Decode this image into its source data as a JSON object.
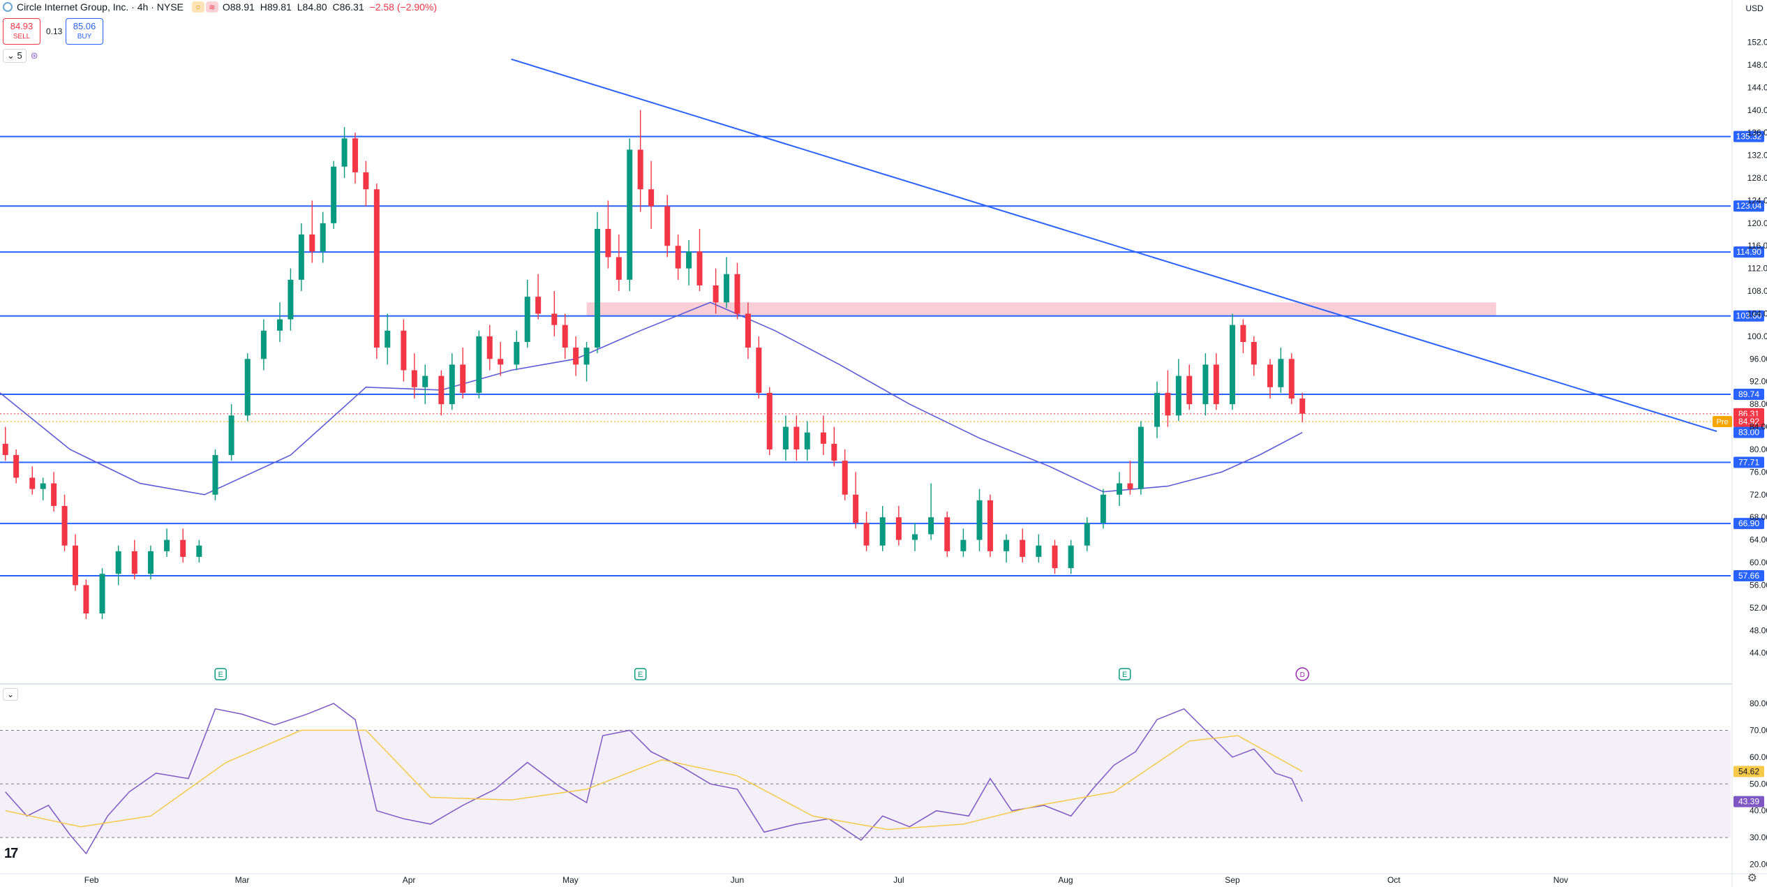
{
  "header": {
    "symbol_title": "Circle Internet Group, Inc. · 4h · NYSE",
    "ohlc": {
      "open": "O88.91",
      "high": "H89.81",
      "low": "L84.80",
      "close": "C86.31",
      "change": "−2.58 (−2.90%)"
    },
    "sell_price": "84.93",
    "sell_label": "SELL",
    "buy_price": "85.06",
    "buy_label": "BUY",
    "spread": "0.13",
    "indicator_count": "5",
    "currency": "USD"
  },
  "colors": {
    "up": "#089981",
    "down": "#f23645",
    "hline": "#2962ff",
    "ma": "#5b5bd6",
    "rsi": "#7e57c2",
    "rsi_ma": "#f7c948",
    "zone": "#f8c6cf"
  },
  "icons": [
    "earnings-icon",
    "dividend-icon",
    "settings-gear-icon",
    "tradingview-logo-icon"
  ],
  "price_axis": [
    "152.00",
    "148.00",
    "144.00",
    "140.00",
    "136.00",
    "132.00",
    "128.00",
    "124.00",
    "120.00",
    "116.00",
    "112.00",
    "108.00",
    "104.00",
    "100.00",
    "96.00",
    "92.00",
    "88.00",
    "84.00",
    "80.00",
    "76.00",
    "72.00",
    "68.00",
    "64.00",
    "60.00",
    "56.00",
    "52.00",
    "48.00",
    "44.00"
  ],
  "time_axis": [
    "Feb",
    "Mar",
    "Apr",
    "May",
    "Jun",
    "Jul",
    "Aug",
    "Sep",
    "Oct",
    "Nov"
  ],
  "rsi_axis": [
    "80.00",
    "70.00",
    "60.00",
    "50.00",
    "40.00",
    "30.00",
    "20.00"
  ],
  "chart_data": {
    "type": "candlestick",
    "title": "Circle Internet Group, Inc. · 4h · NYSE",
    "ylim": [
      41,
      157
    ],
    "horizontal_levels": [
      135.32,
      123.04,
      114.9,
      103.6,
      89.74,
      77.71,
      66.9,
      57.66
    ],
    "level_labels": [
      "135.32",
      "123.04",
      "114.90",
      "103.60",
      "89.74",
      "77.71",
      "66.90",
      "57.66"
    ],
    "price_tags": [
      {
        "label": "86.31",
        "value": 86.31,
        "color": "#f23645"
      },
      {
        "label": "84.92",
        "value": 84.92,
        "color": "#f23645",
        "badge": "Pre"
      },
      {
        "label": "83.00",
        "value": 83.0,
        "color": "#2962ff"
      }
    ],
    "resistance_zone": {
      "from_date": "2025-05-04",
      "to_date": "2025-10-20",
      "low": 103.6,
      "high": 106.0
    },
    "trendline": {
      "from": [
        "2025-04-20",
        149.0
      ],
      "to": [
        "2025-11-30",
        83.2
      ]
    },
    "moving_average_path": [
      [
        "2025-01-15",
        90
      ],
      [
        "2025-01-28",
        80
      ],
      [
        "2025-02-10",
        74
      ],
      [
        "2025-02-22",
        72
      ],
      [
        "2025-03-10",
        79
      ],
      [
        "2025-03-24",
        91
      ],
      [
        "2025-04-07",
        90.5
      ],
      [
        "2025-04-20",
        94
      ],
      [
        "2025-05-02",
        96
      ],
      [
        "2025-05-14",
        101
      ],
      [
        "2025-05-27",
        106
      ],
      [
        "2025-06-08",
        101
      ],
      [
        "2025-06-20",
        95
      ],
      [
        "2025-07-03",
        88
      ],
      [
        "2025-07-16",
        82
      ],
      [
        "2025-07-29",
        77
      ],
      [
        "2025-08-08",
        72.5
      ],
      [
        "2025-08-20",
        73.5
      ],
      [
        "2025-08-30",
        76
      ],
      [
        "2025-09-06",
        79
      ],
      [
        "2025-09-14",
        83
      ]
    ],
    "candles": [
      {
        "t": "2025-01-16",
        "o": 81,
        "h": 84,
        "l": 78,
        "c": 79
      },
      {
        "t": "2025-01-18",
        "o": 79,
        "h": 80,
        "l": 74,
        "c": 75
      },
      {
        "t": "2025-01-21",
        "o": 75,
        "h": 77,
        "l": 72,
        "c": 73
      },
      {
        "t": "2025-01-23",
        "o": 73,
        "h": 75,
        "l": 71,
        "c": 74
      },
      {
        "t": "2025-01-25",
        "o": 74,
        "h": 76,
        "l": 69,
        "c": 70
      },
      {
        "t": "2025-01-27",
        "o": 70,
        "h": 72,
        "l": 62,
        "c": 63
      },
      {
        "t": "2025-01-29",
        "o": 63,
        "h": 65,
        "l": 55,
        "c": 56
      },
      {
        "t": "2025-01-31",
        "o": 56,
        "h": 57,
        "l": 50,
        "c": 51
      },
      {
        "t": "2025-02-03",
        "o": 51,
        "h": 59,
        "l": 50,
        "c": 58
      },
      {
        "t": "2025-02-06",
        "o": 58,
        "h": 63,
        "l": 56,
        "c": 62
      },
      {
        "t": "2025-02-09",
        "o": 62,
        "h": 64,
        "l": 57,
        "c": 58
      },
      {
        "t": "2025-02-12",
        "o": 58,
        "h": 63,
        "l": 57,
        "c": 62
      },
      {
        "t": "2025-02-15",
        "o": 62,
        "h": 66,
        "l": 61,
        "c": 64
      },
      {
        "t": "2025-02-18",
        "o": 64,
        "h": 66,
        "l": 60,
        "c": 61
      },
      {
        "t": "2025-02-21",
        "o": 61,
        "h": 64,
        "l": 60,
        "c": 63
      },
      {
        "t": "2025-02-24",
        "o": 72,
        "h": 80,
        "l": 71,
        "c": 79
      },
      {
        "t": "2025-02-27",
        "o": 79,
        "h": 88,
        "l": 78,
        "c": 86
      },
      {
        "t": "2025-03-02",
        "o": 86,
        "h": 97,
        "l": 85,
        "c": 96
      },
      {
        "t": "2025-03-05",
        "o": 96,
        "h": 103,
        "l": 94,
        "c": 101
      },
      {
        "t": "2025-03-08",
        "o": 101,
        "h": 106,
        "l": 99,
        "c": 103
      },
      {
        "t": "2025-03-10",
        "o": 103,
        "h": 112,
        "l": 101,
        "c": 110
      },
      {
        "t": "2025-03-12",
        "o": 110,
        "h": 120,
        "l": 108,
        "c": 118
      },
      {
        "t": "2025-03-14",
        "o": 118,
        "h": 124,
        "l": 113,
        "c": 115
      },
      {
        "t": "2025-03-16",
        "o": 115,
        "h": 122,
        "l": 113,
        "c": 120
      },
      {
        "t": "2025-03-18",
        "o": 120,
        "h": 131,
        "l": 119,
        "c": 130
      },
      {
        "t": "2025-03-20",
        "o": 130,
        "h": 137,
        "l": 128,
        "c": 135
      },
      {
        "t": "2025-03-22",
        "o": 135,
        "h": 136,
        "l": 127,
        "c": 129
      },
      {
        "t": "2025-03-24",
        "o": 129,
        "h": 131,
        "l": 123,
        "c": 126
      },
      {
        "t": "2025-03-26",
        "o": 126,
        "h": 127,
        "l": 96,
        "c": 98
      },
      {
        "t": "2025-03-28",
        "o": 98,
        "h": 104,
        "l": 95,
        "c": 101
      },
      {
        "t": "2025-03-31",
        "o": 101,
        "h": 103,
        "l": 92,
        "c": 94
      },
      {
        "t": "2025-04-02",
        "o": 94,
        "h": 97,
        "l": 89,
        "c": 91
      },
      {
        "t": "2025-04-04",
        "o": 91,
        "h": 95,
        "l": 88,
        "c": 93
      },
      {
        "t": "2025-04-07",
        "o": 93,
        "h": 94,
        "l": 86,
        "c": 88
      },
      {
        "t": "2025-04-09",
        "o": 88,
        "h": 97,
        "l": 87,
        "c": 95
      },
      {
        "t": "2025-04-11",
        "o": 95,
        "h": 98,
        "l": 89,
        "c": 90
      },
      {
        "t": "2025-04-14",
        "o": 90,
        "h": 101,
        "l": 89,
        "c": 100
      },
      {
        "t": "2025-04-16",
        "o": 100,
        "h": 102,
        "l": 94,
        "c": 96
      },
      {
        "t": "2025-04-18",
        "o": 96,
        "h": 99,
        "l": 93,
        "c": 95
      },
      {
        "t": "2025-04-21",
        "o": 95,
        "h": 101,
        "l": 94,
        "c": 99
      },
      {
        "t": "2025-04-23",
        "o": 99,
        "h": 110,
        "l": 98,
        "c": 107
      },
      {
        "t": "2025-04-25",
        "o": 107,
        "h": 111,
        "l": 103,
        "c": 104
      },
      {
        "t": "2025-04-28",
        "o": 104,
        "h": 108,
        "l": 100,
        "c": 102
      },
      {
        "t": "2025-04-30",
        "o": 102,
        "h": 104,
        "l": 96,
        "c": 98
      },
      {
        "t": "2025-05-02",
        "o": 98,
        "h": 100,
        "l": 93,
        "c": 95
      },
      {
        "t": "2025-05-04",
        "o": 95,
        "h": 99,
        "l": 92,
        "c": 98
      },
      {
        "t": "2025-05-06",
        "o": 98,
        "h": 122,
        "l": 97,
        "c": 119
      },
      {
        "t": "2025-05-08",
        "o": 119,
        "h": 124,
        "l": 112,
        "c": 114
      },
      {
        "t": "2025-05-10",
        "o": 114,
        "h": 118,
        "l": 108,
        "c": 110
      },
      {
        "t": "2025-05-12",
        "o": 110,
        "h": 135,
        "l": 108,
        "c": 133
      },
      {
        "t": "2025-05-14",
        "o": 133,
        "h": 140,
        "l": 122,
        "c": 126
      },
      {
        "t": "2025-05-16",
        "o": 126,
        "h": 131,
        "l": 119,
        "c": 123
      },
      {
        "t": "2025-05-19",
        "o": 123,
        "h": 125,
        "l": 114,
        "c": 116
      },
      {
        "t": "2025-05-21",
        "o": 116,
        "h": 118,
        "l": 110,
        "c": 112
      },
      {
        "t": "2025-05-23",
        "o": 112,
        "h": 117,
        "l": 109,
        "c": 115
      },
      {
        "t": "2025-05-25",
        "o": 115,
        "h": 119,
        "l": 108,
        "c": 109
      },
      {
        "t": "2025-05-28",
        "o": 109,
        "h": 112,
        "l": 104,
        "c": 106
      },
      {
        "t": "2025-05-30",
        "o": 106,
        "h": 114,
        "l": 105,
        "c": 111
      },
      {
        "t": "2025-06-01",
        "o": 111,
        "h": 113,
        "l": 103,
        "c": 104
      },
      {
        "t": "2025-06-03",
        "o": 104,
        "h": 106,
        "l": 96,
        "c": 98
      },
      {
        "t": "2025-06-05",
        "o": 98,
        "h": 100,
        "l": 89,
        "c": 90
      },
      {
        "t": "2025-06-07",
        "o": 90,
        "h": 91,
        "l": 79,
        "c": 80
      },
      {
        "t": "2025-06-10",
        "o": 80,
        "h": 86,
        "l": 78,
        "c": 84
      },
      {
        "t": "2025-06-12",
        "o": 84,
        "h": 86,
        "l": 78,
        "c": 80
      },
      {
        "t": "2025-06-14",
        "o": 80,
        "h": 85,
        "l": 78,
        "c": 83
      },
      {
        "t": "2025-06-17",
        "o": 83,
        "h": 86,
        "l": 79,
        "c": 81
      },
      {
        "t": "2025-06-19",
        "o": 81,
        "h": 84,
        "l": 77,
        "c": 78
      },
      {
        "t": "2025-06-21",
        "o": 78,
        "h": 80,
        "l": 71,
        "c": 72
      },
      {
        "t": "2025-06-23",
        "o": 72,
        "h": 76,
        "l": 66,
        "c": 67
      },
      {
        "t": "2025-06-25",
        "o": 67,
        "h": 69,
        "l": 62,
        "c": 63
      },
      {
        "t": "2025-06-28",
        "o": 63,
        "h": 70,
        "l": 62,
        "c": 68
      },
      {
        "t": "2025-07-01",
        "o": 68,
        "h": 70,
        "l": 63,
        "c": 64
      },
      {
        "t": "2025-07-04",
        "o": 64,
        "h": 67,
        "l": 62,
        "c": 65
      },
      {
        "t": "2025-07-07",
        "o": 65,
        "h": 74,
        "l": 64,
        "c": 68
      },
      {
        "t": "2025-07-10",
        "o": 68,
        "h": 69,
        "l": 61,
        "c": 62
      },
      {
        "t": "2025-07-13",
        "o": 62,
        "h": 66,
        "l": 61,
        "c": 64
      },
      {
        "t": "2025-07-16",
        "o": 64,
        "h": 73,
        "l": 62,
        "c": 71
      },
      {
        "t": "2025-07-18",
        "o": 71,
        "h": 72,
        "l": 61,
        "c": 62
      },
      {
        "t": "2025-07-21",
        "o": 62,
        "h": 65,
        "l": 60,
        "c": 64
      },
      {
        "t": "2025-07-24",
        "o": 64,
        "h": 66,
        "l": 60,
        "c": 61
      },
      {
        "t": "2025-07-27",
        "o": 61,
        "h": 65,
        "l": 60,
        "c": 63
      },
      {
        "t": "2025-07-30",
        "o": 63,
        "h": 64,
        "l": 58,
        "c": 59
      },
      {
        "t": "2025-08-02",
        "o": 59,
        "h": 64,
        "l": 58,
        "c": 63
      },
      {
        "t": "2025-08-05",
        "o": 63,
        "h": 68,
        "l": 62,
        "c": 67
      },
      {
        "t": "2025-08-08",
        "o": 67,
        "h": 73,
        "l": 66,
        "c": 72
      },
      {
        "t": "2025-08-11",
        "o": 72,
        "h": 76,
        "l": 70,
        "c": 74
      },
      {
        "t": "2025-08-13",
        "o": 74,
        "h": 78,
        "l": 72,
        "c": 73
      },
      {
        "t": "2025-08-15",
        "o": 73,
        "h": 85,
        "l": 72,
        "c": 84
      },
      {
        "t": "2025-08-18",
        "o": 84,
        "h": 92,
        "l": 82,
        "c": 90
      },
      {
        "t": "2025-08-20",
        "o": 90,
        "h": 94,
        "l": 84,
        "c": 86
      },
      {
        "t": "2025-08-22",
        "o": 86,
        "h": 96,
        "l": 85,
        "c": 93
      },
      {
        "t": "2025-08-24",
        "o": 93,
        "h": 95,
        "l": 87,
        "c": 88
      },
      {
        "t": "2025-08-27",
        "o": 88,
        "h": 97,
        "l": 86,
        "c": 95
      },
      {
        "t": "2025-08-29",
        "o": 95,
        "h": 97,
        "l": 87,
        "c": 88
      },
      {
        "t": "2025-09-01",
        "o": 88,
        "h": 104,
        "l": 87,
        "c": 102
      },
      {
        "t": "2025-09-03",
        "o": 102,
        "h": 103,
        "l": 97,
        "c": 99
      },
      {
        "t": "2025-09-05",
        "o": 99,
        "h": 100,
        "l": 93,
        "c": 95
      },
      {
        "t": "2025-09-08",
        "o": 95,
        "h": 96,
        "l": 89,
        "c": 91
      },
      {
        "t": "2025-09-10",
        "o": 91,
        "h": 98,
        "l": 90,
        "c": 96
      },
      {
        "t": "2025-09-12",
        "o": 96,
        "h": 97,
        "l": 88,
        "c": 89
      },
      {
        "t": "2025-09-14",
        "o": 89,
        "h": 90,
        "l": 84.8,
        "c": 86.31
      }
    ],
    "event_markers": [
      {
        "date": "2025-02-25",
        "type": "earnings",
        "label": "E"
      },
      {
        "date": "2025-05-14",
        "type": "earnings",
        "label": "E"
      },
      {
        "date": "2025-08-12",
        "type": "earnings",
        "label": "E"
      },
      {
        "date": "2025-09-14",
        "type": "dividend",
        "label": "D"
      }
    ],
    "rsi": {
      "ylim": [
        17,
        86
      ],
      "upper": 70,
      "middle": 50,
      "lower": 30,
      "label_rsi": "43.39",
      "label_ma": "54.62",
      "points": [
        [
          "2025-01-16",
          47
        ],
        [
          "2025-01-20",
          38
        ],
        [
          "2025-01-24",
          42
        ],
        [
          "2025-01-28",
          31
        ],
        [
          "2025-01-31",
          24
        ],
        [
          "2025-02-04",
          38
        ],
        [
          "2025-02-08",
          47
        ],
        [
          "2025-02-13",
          54
        ],
        [
          "2025-02-19",
          52
        ],
        [
          "2025-02-24",
          78
        ],
        [
          "2025-03-01",
          76
        ],
        [
          "2025-03-07",
          72
        ],
        [
          "2025-03-13",
          76
        ],
        [
          "2025-03-18",
          80
        ],
        [
          "2025-03-22",
          74
        ],
        [
          "2025-03-26",
          40
        ],
        [
          "2025-03-31",
          37
        ],
        [
          "2025-04-05",
          35
        ],
        [
          "2025-04-11",
          42
        ],
        [
          "2025-04-17",
          48
        ],
        [
          "2025-04-23",
          58
        ],
        [
          "2025-04-29",
          49
        ],
        [
          "2025-05-04",
          43
        ],
        [
          "2025-05-07",
          68
        ],
        [
          "2025-05-12",
          70
        ],
        [
          "2025-05-16",
          62
        ],
        [
          "2025-05-22",
          56
        ],
        [
          "2025-05-27",
          50
        ],
        [
          "2025-06-01",
          48
        ],
        [
          "2025-06-06",
          32
        ],
        [
          "2025-06-12",
          35
        ],
        [
          "2025-06-18",
          37
        ],
        [
          "2025-06-24",
          29
        ],
        [
          "2025-06-28",
          38
        ],
        [
          "2025-07-03",
          34
        ],
        [
          "2025-07-08",
          40
        ],
        [
          "2025-07-14",
          38
        ],
        [
          "2025-07-18",
          52
        ],
        [
          "2025-07-22",
          40
        ],
        [
          "2025-07-28",
          42
        ],
        [
          "2025-08-02",
          38
        ],
        [
          "2025-08-06",
          48
        ],
        [
          "2025-08-10",
          57
        ],
        [
          "2025-08-14",
          62
        ],
        [
          "2025-08-18",
          74
        ],
        [
          "2025-08-23",
          78
        ],
        [
          "2025-08-28",
          68
        ],
        [
          "2025-09-01",
          60
        ],
        [
          "2025-09-05",
          63
        ],
        [
          "2025-09-09",
          54
        ],
        [
          "2025-09-12",
          52
        ],
        [
          "2025-09-14",
          43.39
        ]
      ],
      "ma_points": [
        [
          "2025-01-16",
          40
        ],
        [
          "2025-01-30",
          34
        ],
        [
          "2025-02-12",
          38
        ],
        [
          "2025-02-26",
          58
        ],
        [
          "2025-03-12",
          70
        ],
        [
          "2025-03-24",
          70
        ],
        [
          "2025-04-05",
          45
        ],
        [
          "2025-04-20",
          44
        ],
        [
          "2025-05-04",
          48
        ],
        [
          "2025-05-18",
          59
        ],
        [
          "2025-06-01",
          53
        ],
        [
          "2025-06-15",
          38
        ],
        [
          "2025-06-29",
          33
        ],
        [
          "2025-07-13",
          35
        ],
        [
          "2025-07-27",
          42
        ],
        [
          "2025-08-10",
          47
        ],
        [
          "2025-08-24",
          66
        ],
        [
          "2025-09-02",
          68
        ],
        [
          "2025-09-14",
          54.62
        ]
      ]
    }
  }
}
